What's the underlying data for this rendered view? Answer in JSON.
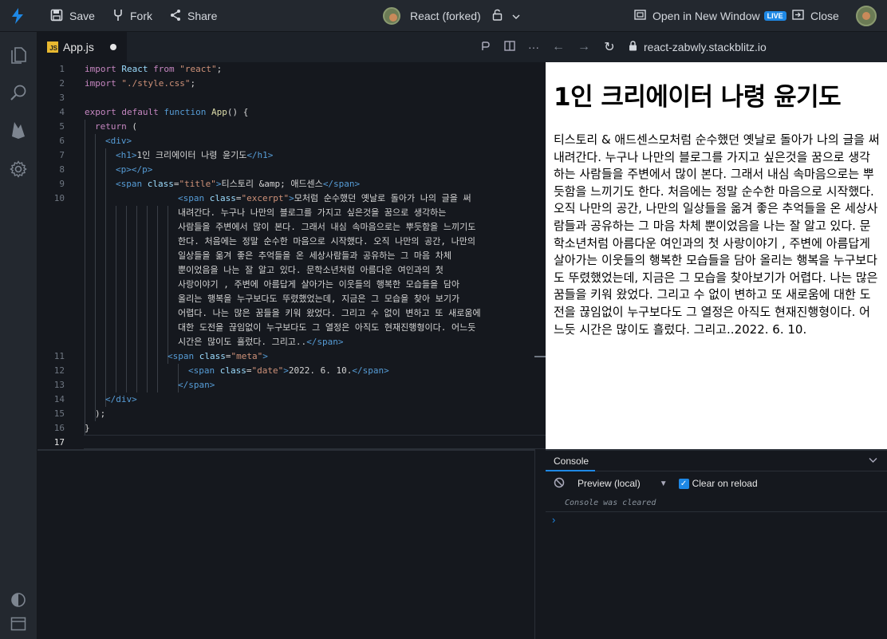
{
  "topbar": {
    "save_label": "Save",
    "fork_label": "Fork",
    "share_label": "Share",
    "project_title": "React (forked)",
    "open_window_label": "Open in New Window",
    "live_badge": "LIVE",
    "close_label": "Close"
  },
  "editor": {
    "tab_label": "App.js",
    "tab_badge": "JS"
  },
  "browser": {
    "url": "react-zabwly.stackblitz.io"
  },
  "preview": {
    "heading": "1인 크리에이터 나령 윤기도",
    "paragraph": "티스토리 & 애드센스모처럼 순수했던 옛날로 돌아가 나의 글을 써 내려간다. 누구나 나만의 블로그를 가지고 싶은것을 꿈으로 생각하는 사람들을 주변에서 많이 본다. 그래서 내심 속마음으로는 뿌듯함을 느끼기도 한다. 처음에는 정말 순수한 마음으로 시작했다. 오직 나만의 공간, 나만의 일상들을 옮겨 좋은 추억들을 온 세상사람들과 공유하는 그 마음 차체 뿐이었음을 나는 잘 알고 있다. 문학소년처럼 아름다운 여인과의 첫 사랑이야기 , 주변에 아름답게 살아가는 이웃들의 행복한 모습들을 담아 올리는 행복을 누구보다도 뚜렸했었는데, 지금은 그 모습을 찾아보기가 어렵다. 나는 많은 꿈들을 키워 왔었다. 그리고 수 없이 변하고 또 새로움에 대한 도전을 끊임없이 누구보다도 그 열정은 아직도 현재진행형이다. 어느듯 시간은 많이도 흘렀다. 그리고..2022. 6. 10."
  },
  "console": {
    "tab_label": "Console",
    "context_label": "Preview (local)",
    "clear_on_reload_label": "Clear on reload",
    "cleared_message": "Console was cleared",
    "prompt": "›"
  },
  "code": {
    "line_numbers": [
      "1",
      "2",
      "3",
      "4",
      "5",
      "6",
      "7",
      "8",
      "9",
      "10",
      "11",
      "12",
      "13",
      "14",
      "15",
      "16",
      "17"
    ],
    "l1_import": "import",
    "l1_react": "React",
    "l1_from": "from",
    "l1_str": "\"react\"",
    "l1_end": ";",
    "l2_import": "import",
    "l2_str": "\"./style.css\"",
    "l2_end": ";",
    "l4_export": "export",
    "l4_default": "default",
    "l4_function": "function",
    "l4_name": "App",
    "l4_rest": "() {",
    "l5_return": "return",
    "l5_rest": " (",
    "l6": "<div>",
    "l7_open": "<h1>",
    "l7_text": "1인 크리에이터 나령 윤기도",
    "l7_close": "</h1>",
    "l8": "<p></p>",
    "l9_open": "<span",
    "l9_attr": "class",
    "l9_eq": "=",
    "l9_val": "\"title\"",
    "l9_gt": ">",
    "l9_text": "티스토리 &amp; 애드센스",
    "l9_close": "</span>",
    "l10_open": "<span",
    "l10_attr": "class",
    "l10_eq": "=",
    "l10_val": "\"excerpt\"",
    "l10_gt": ">",
    "l10_text_1": "모처럼 순수했던 옛날로 돌아가 나의 글을 써",
    "l10_text_2": "내려간다. 누구나 나만의 블로그를 가지고 싶은것을 꿈으로 생각하는",
    "l10_text_3": "사람들을 주변에서 많이 본다. 그래서 내심 속마음으로는 뿌듯함을 느끼기도",
    "l10_text_4": "한다. 처음에는 정말 순수한 마음으로 시작했다. 오직 나만의 공간, 나만의",
    "l10_text_5": "일상들을 옮겨 좋은 추억들을 온 세상사람들과 공유하는 그 마음 차체",
    "l10_text_6": "뿐이었음을 나는 잘 알고 있다. 문학소년처럼 아름다운 여인과의 첫",
    "l10_text_7": "사랑이야기 , 주변에 아름답게 살아가는 이웃들의 행복한 모습들을 담아",
    "l10_text_8": "올리는 행복을 누구보다도 뚜렸했었는데, 지금은 그 모습을 찾아 보기가",
    "l10_text_9": "어렵다. 나는 많은 꿈들을 키워 왔었다. 그리고 수 없이 변하고 또 새로움에",
    "l10_text_10": "대한 도전을 끊임없이 누구보다도 그 열정은 아직도 현재진행형이다. 어느듯",
    "l10_text_11": "시간은 많이도 흘렀다. 그리고..",
    "l10_close": "</span>",
    "l11_open": "<span",
    "l11_attr": "class",
    "l11_eq": "=",
    "l11_val": "\"meta\"",
    "l11_gt": ">",
    "l12_open": "<span",
    "l12_attr": "class",
    "l12_eq": "=",
    "l12_val": "\"date\"",
    "l12_gt": ">",
    "l12_text": "2022. 6. 10.",
    "l12_close": "</span>",
    "l13": "</span>",
    "l14": "</div>",
    "l15": ");",
    "l16": "}"
  }
}
